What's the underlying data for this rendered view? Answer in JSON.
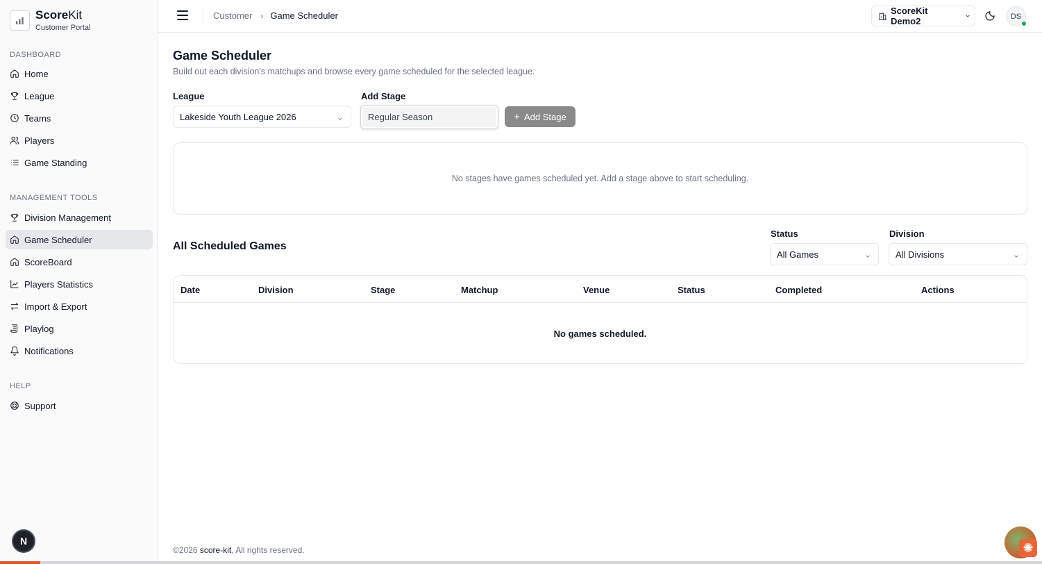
{
  "brand": {
    "name_bold": "Score",
    "name_thin": "Kit",
    "subtitle": "Customer Portal"
  },
  "sidebar": {
    "sections": [
      {
        "title": "DASHBOARD",
        "items": [
          {
            "label": "Home",
            "icon": "home-icon"
          },
          {
            "label": "League",
            "icon": "trophy-icon"
          },
          {
            "label": "Teams",
            "icon": "teams-icon"
          },
          {
            "label": "Players",
            "icon": "users-icon"
          },
          {
            "label": "Game Standing",
            "icon": "list-icon"
          }
        ]
      },
      {
        "title": "MANAGEMENT TOOLS",
        "items": [
          {
            "label": "Division Management",
            "icon": "trophy-icon"
          },
          {
            "label": "Game Scheduler",
            "icon": "home-icon",
            "active": true
          },
          {
            "label": "ScoreBoard",
            "icon": "home-icon"
          },
          {
            "label": "Players Statistics",
            "icon": "chart-icon"
          },
          {
            "label": "Import & Export",
            "icon": "transfer-icon"
          },
          {
            "label": "Playlog",
            "icon": "scroll-icon"
          },
          {
            "label": "Notifications",
            "icon": "bell-icon"
          }
        ]
      },
      {
        "title": "HELP",
        "items": [
          {
            "label": "Support",
            "icon": "lifebuoy-icon"
          }
        ]
      }
    ],
    "bottom_avatar_letter": "N"
  },
  "header": {
    "breadcrumb": [
      "Customer",
      "Game Scheduler"
    ],
    "org_switch": "ScoreKit Demo2",
    "avatar_initials": "DS"
  },
  "main": {
    "title": "Game Scheduler",
    "description": "Build out each division's matchups and browse every game scheduled for the selected league.",
    "league_label": "League",
    "league_value": "Lakeside Youth League 2026",
    "add_stage_label": "Add Stage",
    "stage_input_value": "Regular Season",
    "add_stage_button": "Add Stage",
    "empty_stages_text": "No stages have games scheduled yet. Add a stage above to start scheduling.",
    "scheduled_heading": "All Scheduled Games",
    "status_label": "Status",
    "status_value": "All Games",
    "division_label": "Division",
    "division_value": "All Divisions",
    "table_columns": [
      "Date",
      "Division",
      "Stage",
      "Matchup",
      "Venue",
      "Status",
      "Completed",
      "Actions"
    ],
    "empty_table_text": "No games scheduled."
  },
  "footer": {
    "prefix": "©2026 ",
    "brand": "score-kit",
    "suffix": ", All rights reserved."
  }
}
